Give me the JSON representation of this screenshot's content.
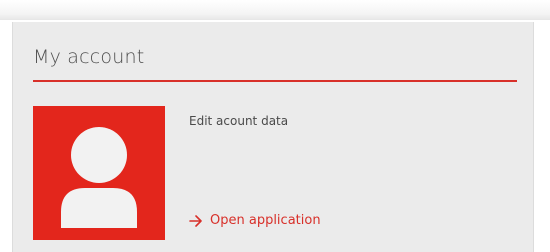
{
  "account_card": {
    "title": "My account",
    "description": "Edit acount data",
    "link_label": "Open application",
    "link_icon": "arrow-right-icon",
    "avatar_icon": "user-silhouette-icon",
    "accent_color": "#e3261c",
    "card_background": "#ebebeb"
  }
}
